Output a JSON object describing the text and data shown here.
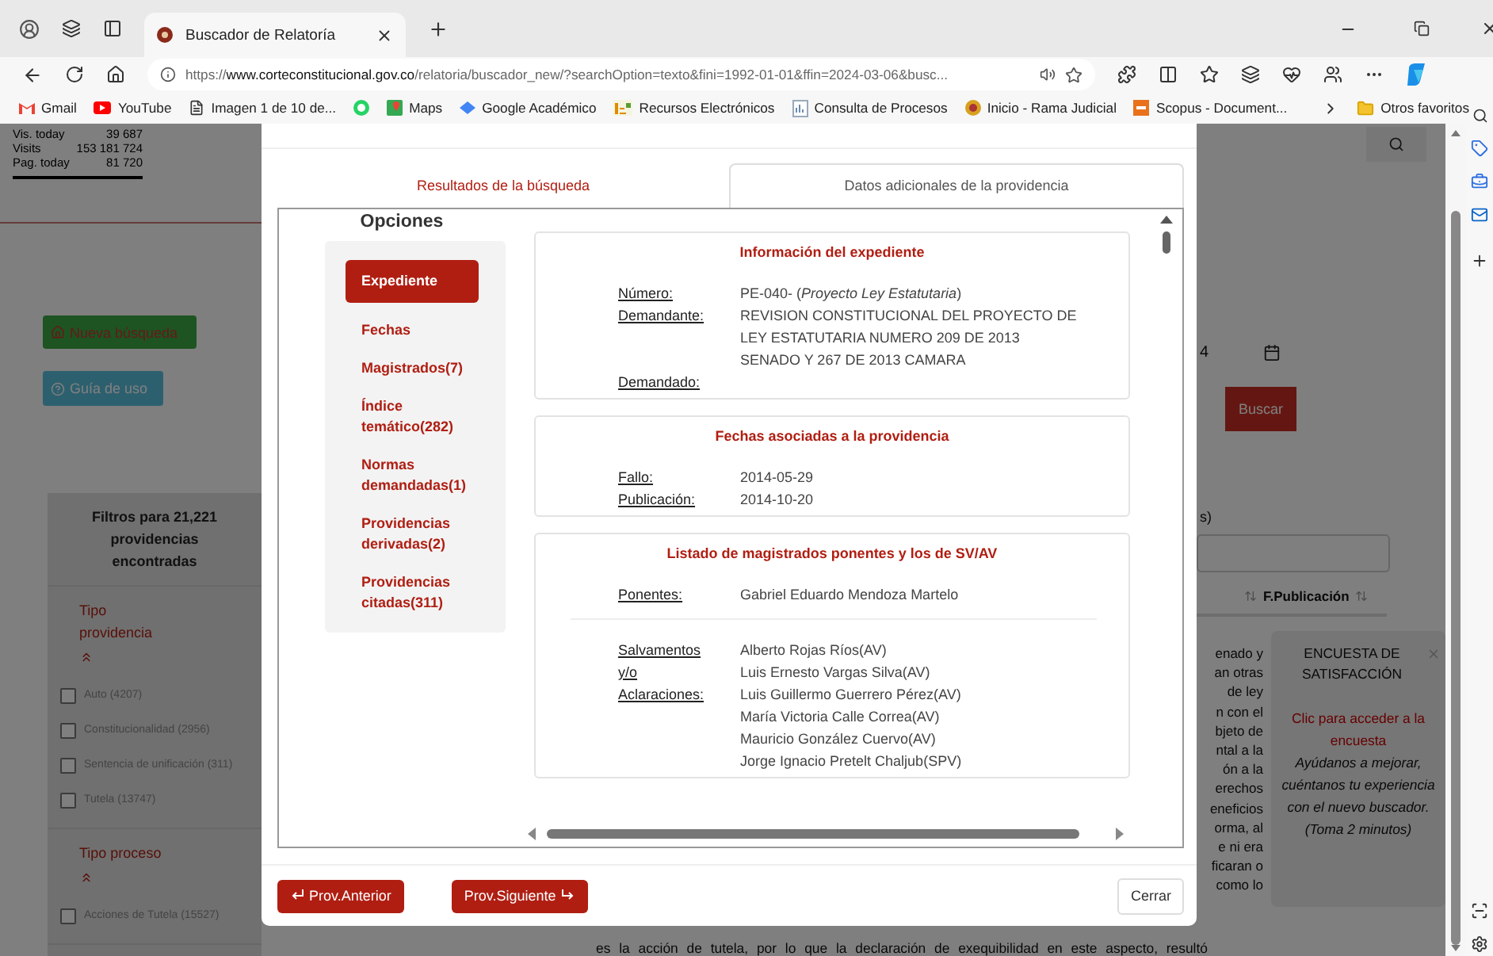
{
  "browser": {
    "tab": {
      "title": "Buscador de Relatoría"
    },
    "url": {
      "scheme": "https://",
      "host": "www.corteconstitucional.gov.co",
      "rest": "/relatoria/buscador_new/?searchOption=texto&fini=1992-01-01&ffin=2024-03-06&busc..."
    },
    "bookmarks": [
      {
        "kind": "gmail",
        "label": "Gmail"
      },
      {
        "kind": "youtube",
        "label": "YouTube"
      },
      {
        "kind": "page",
        "label": "Imagen 1 de 10 de..."
      },
      {
        "kind": "whatsapp"
      },
      {
        "kind": "maps",
        "label": "Maps"
      },
      {
        "kind": "scholar",
        "label": "Google Académico"
      },
      {
        "kind": "library",
        "label": "Recursos Electrónicos"
      },
      {
        "kind": "chart",
        "label": "Consulta de Procesos"
      },
      {
        "kind": "judiciary",
        "label": "Inicio - Rama Judicial"
      },
      {
        "kind": "scopus",
        "label": "Scopus - Document..."
      }
    ],
    "other_favorites": "Otros favoritos"
  },
  "page": {
    "stats": [
      {
        "label": "Vis. today",
        "value": "39 687"
      },
      {
        "label": "Visits",
        "value": "153 181 724"
      },
      {
        "label": "Pag. today",
        "value": "81 720"
      }
    ],
    "new_search": "Nueva búsqueda",
    "guide": "Guía de uso",
    "filters": {
      "title": "Filtros para 21,221 providencias encontradas",
      "groups": [
        {
          "title": "Tipo providencia",
          "options": [
            {
              "label": "Auto (4207)",
              "checked": false
            },
            {
              "label": "Constitucionalidad (2956)",
              "checked": false
            },
            {
              "label": "Sentencia de unificación (311)",
              "checked": false
            },
            {
              "label": "Tutela (13747)",
              "checked": false
            }
          ]
        },
        {
          "title": "Tipo proceso",
          "options": [
            {
              "label": "Acciones de Tutela (15527)",
              "checked": false
            }
          ]
        }
      ]
    },
    "date_fragment": "4",
    "search_button": "Buscar",
    "label_fragment": "s)",
    "column_header": "F.Publicación",
    "text_fragments": [
      "enado y",
      "an otras",
      "de ley",
      "n con el",
      "bjeto de",
      "ntal a la",
      "ón a la",
      "erechos",
      "eneficios",
      "orma, al",
      "e ni era",
      "ficaran o",
      "como lo"
    ],
    "bottom_line": "es la acción de tutela, por lo que la declaración de exequibilidad en este aspecto, resultó",
    "survey": {
      "title": "ENCUESTA DE SATISFACCIÓN",
      "link": "Clic para acceder a la encuesta",
      "note": "Ayúdanos a mejorar, cuéntanos tu experiencia con el nuevo buscador. (Toma 2 minutos)"
    }
  },
  "modal": {
    "tabs": [
      {
        "label": "Resultados de la búsqueda",
        "selected": false
      },
      {
        "label": "Datos adicionales de la providencia",
        "selected": true
      }
    ],
    "options_title": "Opciones",
    "options": [
      {
        "label": "Expediente",
        "selected": true
      },
      {
        "label": "Fechas",
        "selected": false
      },
      {
        "label": "Magistrados(7)",
        "selected": false
      },
      {
        "label": "Índice temático(282)",
        "selected": false
      },
      {
        "label": "Normas demandadas(1)",
        "selected": false
      },
      {
        "label": "Providencias derivadas(2)",
        "selected": false
      },
      {
        "label": "Providencias citadas(311)",
        "selected": false
      }
    ],
    "sections": [
      {
        "title": "Información del expediente",
        "groups": [
          {
            "fields": [
              {
                "label": "Número:",
                "values": [
                  "PE-040- (*Proyecto Ley Estatutaria*)"
                ]
              },
              {
                "label": "Demandante:",
                "values": [
                  "REVISION CONSTITUCIONAL DEL PROYECTO DE",
                  "LEY ESTATUTARIA NUMERO 209 DE 2013",
                  "SENADO Y 267 DE 2013 CAMARA"
                ]
              },
              {
                "label": "Demandado:"
              }
            ]
          }
        ]
      },
      {
        "title": "Fechas asociadas a la providencia",
        "groups": [
          {
            "fields": [
              {
                "label": "Fallo:",
                "values": [
                  "2014-05-29"
                ]
              },
              {
                "label": "Publicación:",
                "values": [
                  "2014-10-20"
                ]
              }
            ]
          }
        ]
      },
      {
        "title": "Listado de magistrados ponentes y los de SV/AV",
        "groups": [
          {
            "fields": [
              {
                "label": "Ponentes:",
                "values": [
                  "Gabriel Eduardo Mendoza Martelo"
                ]
              }
            ]
          },
          {
            "fields": [
              {
                "label": "Salvamentos y/o Aclaraciones:",
                "values": [
                  "Alberto Rojas Ríos(AV)",
                  "Luis Ernesto Vargas Silva(AV)",
                  "Luis Guillermo Guerrero Pérez(AV)",
                  "María Victoria Calle Correa(AV)",
                  "Mauricio González Cuervo(AV)",
                  "Jorge Ignacio Pretelt Chaljub(SPV)"
                ]
              }
            ]
          }
        ]
      }
    ],
    "prev_button": "Prov.Anterior",
    "next_button": "Prov.Siguiente",
    "close_button": "Cerrar"
  }
}
